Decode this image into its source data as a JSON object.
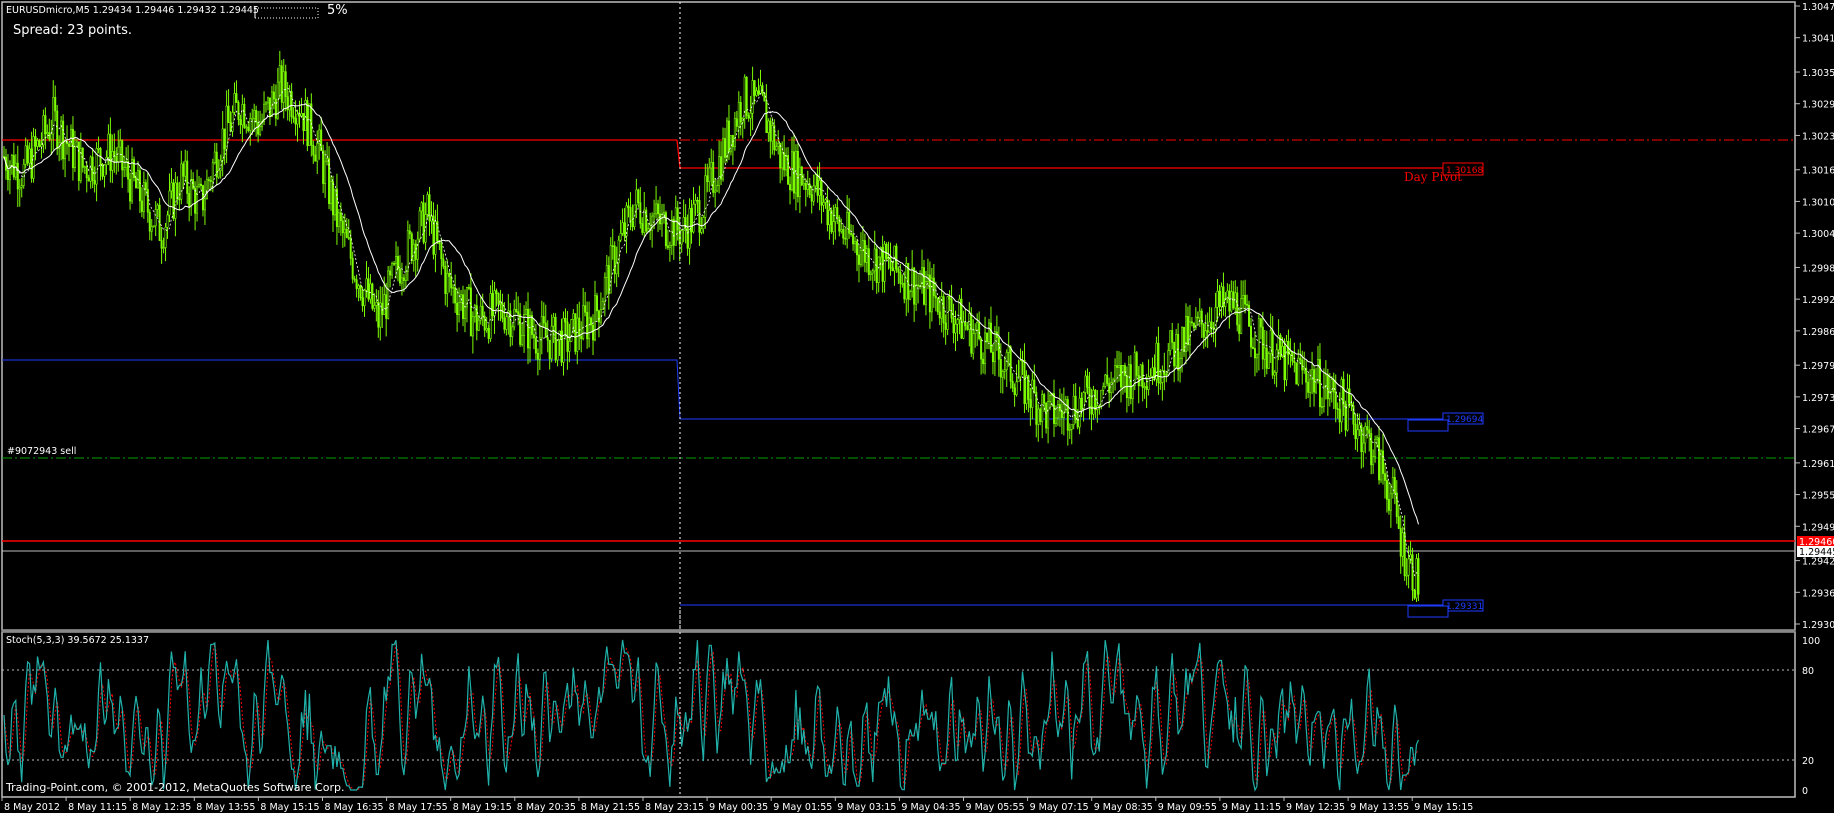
{
  "header": {
    "symbol_info": "EURUSDmicro,M5  1.29434 1.29446 1.29432 1.29445",
    "progress_label": "5%",
    "spread_text": "Spread: 23 points."
  },
  "price_axis": {
    "labels": [
      "1.30475",
      "1.30415",
      "1.30350",
      "1.30290",
      "1.30230",
      "1.30165",
      "1.30105",
      "1.30045",
      "1.29980",
      "1.29920",
      "1.29860",
      "1.29795",
      "1.29735",
      "1.29675",
      "1.29610",
      "1.29550",
      "1.29490",
      "1.29425",
      "1.29365",
      "1.29305"
    ],
    "current_price": "1.29445",
    "red_line_price": "1.29460"
  },
  "order_label": "#9072943 sell",
  "pivot": {
    "label": "Day Pivot",
    "value": "1.30168"
  },
  "level_boxes": {
    "upper_blue": "1.29694",
    "lower_blue": "1.29331"
  },
  "stoch": {
    "title": "Stoch(5,3,3) 39.5672 25.1337",
    "levels": [
      "100",
      "80",
      "20",
      "0"
    ]
  },
  "time_axis": [
    "8 May 2012",
    "8 May 11:15",
    "8 May 12:35",
    "8 May 13:55",
    "8 May 15:15",
    "8 May 16:35",
    "8 May 17:55",
    "8 May 19:15",
    "8 May 20:35",
    "8 May 21:55",
    "8 May 23:15",
    "9 May 00:35",
    "9 May 01:55",
    "9 May 03:15",
    "9 May 04:35",
    "9 May 05:55",
    "9 May 07:15",
    "9 May 08:35",
    "9 May 09:55",
    "9 May 11:15",
    "9 May 12:35",
    "9 May 13:55",
    "9 May 15:15"
  ],
  "copyright": "Trading-Point.com, © 2001-2012, MetaQuotes Software Corp.",
  "colors": {
    "background": "#000000",
    "candles": "#7CFC00",
    "ma_line": "#ffffff",
    "resistance": "#ff0000",
    "support": "#0000cc",
    "order_line": "#00a000",
    "stoch_main": "#20b2aa",
    "stoch_signal": "#ff0000"
  },
  "chart_data": {
    "type": "candlestick",
    "symbol": "EURUSDmicro",
    "timeframe": "M5",
    "close_path": [
      [
        0,
        1.3019
      ],
      [
        10,
        1.3016
      ],
      [
        25,
        1.3026
      ],
      [
        40,
        1.3017
      ],
      [
        55,
        1.302
      ],
      [
        70,
        1.3011
      ],
      [
        80,
        1.3005
      ],
      [
        90,
        1.3015
      ],
      [
        100,
        1.301
      ],
      [
        110,
        1.3022
      ],
      [
        120,
        1.3029
      ],
      [
        130,
        1.3025
      ],
      [
        140,
        1.3032
      ],
      [
        150,
        1.3029
      ],
      [
        160,
        1.302
      ],
      [
        170,
        1.3006
      ],
      [
        180,
        1.2996
      ],
      [
        190,
        1.2988
      ],
      [
        200,
        1.2998
      ],
      [
        215,
        1.3008
      ],
      [
        225,
        1.2995
      ],
      [
        240,
        1.2988
      ],
      [
        255,
        1.299
      ],
      [
        270,
        1.2985
      ],
      [
        285,
        1.2984
      ],
      [
        300,
        1.2989
      ],
      [
        310,
        1.3
      ],
      [
        320,
        1.301
      ],
      [
        335,
        1.3006
      ],
      [
        345,
        1.3005
      ],
      [
        355,
        1.301
      ],
      [
        365,
        1.302
      ],
      [
        375,
        1.303
      ],
      [
        385,
        1.3028
      ],
      [
        395,
        1.3018
      ],
      [
        410,
        1.3014
      ],
      [
        425,
        1.3005
      ],
      [
        440,
        1.3
      ],
      [
        455,
        1.2997
      ],
      [
        470,
        1.2993
      ],
      [
        485,
        1.2988
      ],
      [
        500,
        1.2983
      ],
      [
        515,
        1.2977
      ],
      [
        530,
        1.297
      ],
      [
        545,
        1.2972
      ],
      [
        560,
        1.2976
      ],
      [
        575,
        1.2978
      ],
      [
        590,
        1.2981
      ],
      [
        605,
        1.2986
      ],
      [
        615,
        1.299
      ],
      [
        625,
        1.2991
      ],
      [
        635,
        1.2985
      ],
      [
        650,
        1.298
      ],
      [
        665,
        1.2977
      ],
      [
        680,
        1.2972
      ],
      [
        695,
        1.2964
      ],
      [
        705,
        1.2954
      ],
      [
        710,
        1.2945
      ],
      [
        718,
        1.2938
      ]
    ],
    "price_range": [
      1.29305,
      1.30475
    ],
    "moving_average": true,
    "stochastic": {
      "k": 39.5672,
      "d": 25.1337,
      "levels": [
        80,
        20
      ],
      "range": [
        0,
        100
      ]
    }
  }
}
